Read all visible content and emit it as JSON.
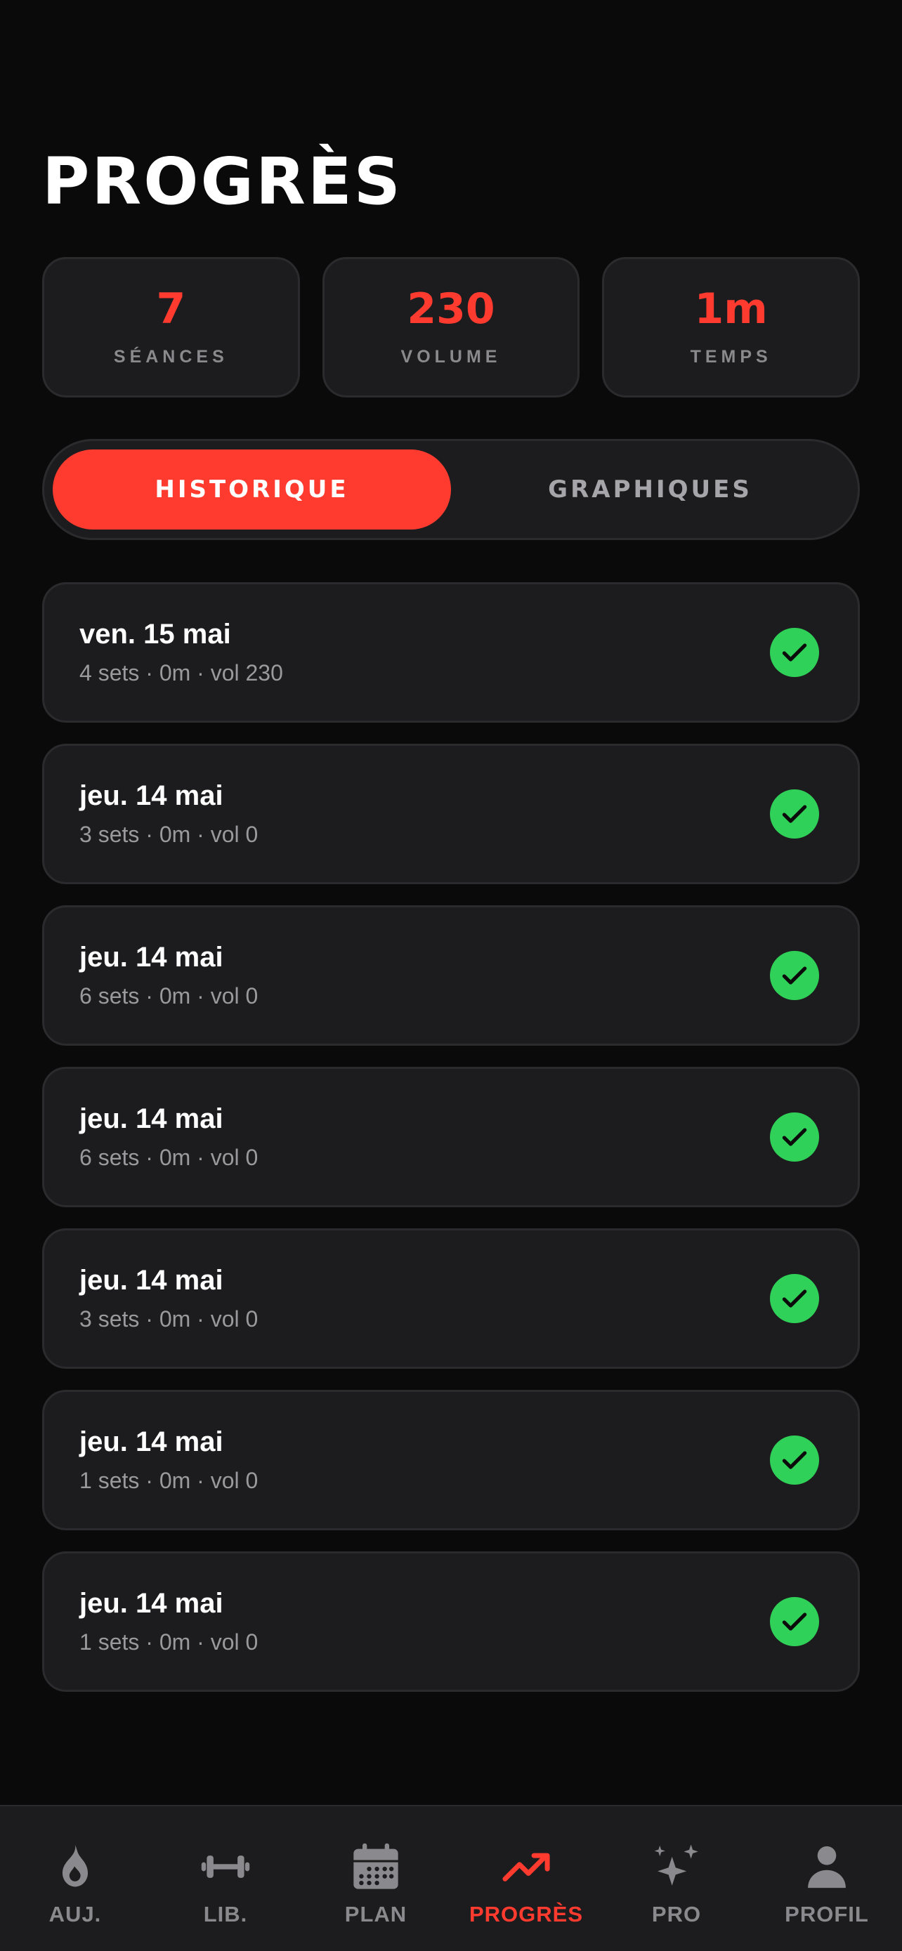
{
  "header": {
    "title": "PROGRÈS"
  },
  "stats": [
    {
      "value": "7",
      "label": "SÉANCES"
    },
    {
      "value": "230",
      "label": "VOLUME"
    },
    {
      "value": "1m",
      "label": "TEMPS"
    }
  ],
  "segments": {
    "history": "HISTORIQUE",
    "charts": "GRAPHIQUES",
    "active": "history"
  },
  "sessions": [
    {
      "date": "ven. 15 mai",
      "meta": "4 sets · 0m · vol 230",
      "status": "completed"
    },
    {
      "date": "jeu. 14 mai",
      "meta": "3 sets · 0m · vol 0",
      "status": "completed"
    },
    {
      "date": "jeu. 14 mai",
      "meta": "6 sets · 0m · vol 0",
      "status": "completed"
    },
    {
      "date": "jeu. 14 mai",
      "meta": "6 sets · 0m · vol 0",
      "status": "completed"
    },
    {
      "date": "jeu. 14 mai",
      "meta": "3 sets · 0m · vol 0",
      "status": "completed"
    },
    {
      "date": "jeu. 14 mai",
      "meta": "1 sets · 0m · vol 0",
      "status": "completed"
    },
    {
      "date": "jeu. 14 mai",
      "meta": "1 sets · 0m · vol 0",
      "status": "completed"
    }
  ],
  "tabbar": {
    "items": [
      {
        "label": "AUJ.",
        "icon": "flame-icon"
      },
      {
        "label": "LIB.",
        "icon": "dumbbell-icon"
      },
      {
        "label": "PLAN",
        "icon": "calendar-icon"
      },
      {
        "label": "PROGRÈS",
        "icon": "trending-up-icon"
      },
      {
        "label": "PRO",
        "icon": "sparkles-icon"
      },
      {
        "label": "PROFIL",
        "icon": "person-icon"
      }
    ],
    "active_index": 3
  },
  "colors": {
    "accent": "#ff3b30",
    "success": "#30d158",
    "background": "#0a0a0a",
    "card": "#1c1c1e",
    "muted": "#8a8a8e"
  }
}
